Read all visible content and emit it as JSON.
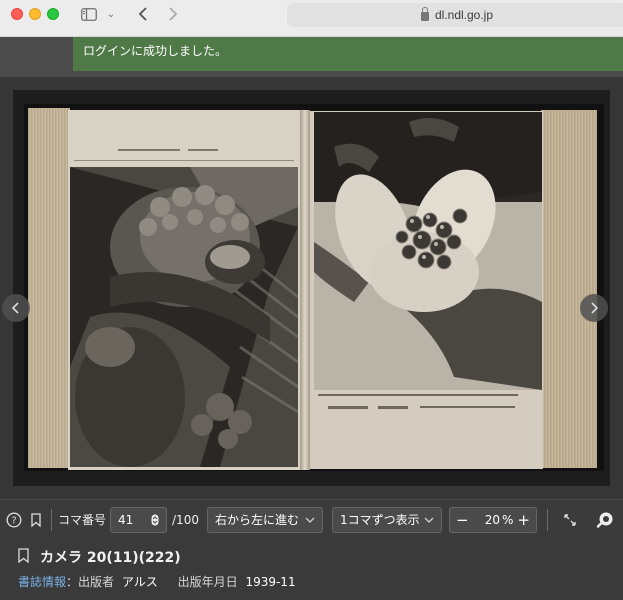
{
  "browser": {
    "url": "dl.ndl.go.jp"
  },
  "notice": {
    "message": "ログインに成功しました。"
  },
  "toolbar": {
    "frame_label": "コマ番号",
    "frame_value": "41",
    "frame_total": "/100",
    "direction_label": "右から左に進む",
    "display_label": "1コマずつ表示",
    "zoom_value": "20",
    "zoom_unit": "%",
    "zoom_minus": "−",
    "zoom_plus": "+"
  },
  "meta": {
    "title": "カメラ 20(11)(222)",
    "bib_link": "書誌情報",
    "sep": "：",
    "publisher_label": "出版者",
    "publisher": "アルス",
    "date_label": "出版年月日",
    "date": "1939-11"
  },
  "colors": {
    "notice_bg": "#4f7a47",
    "link": "#7ab0e6"
  }
}
